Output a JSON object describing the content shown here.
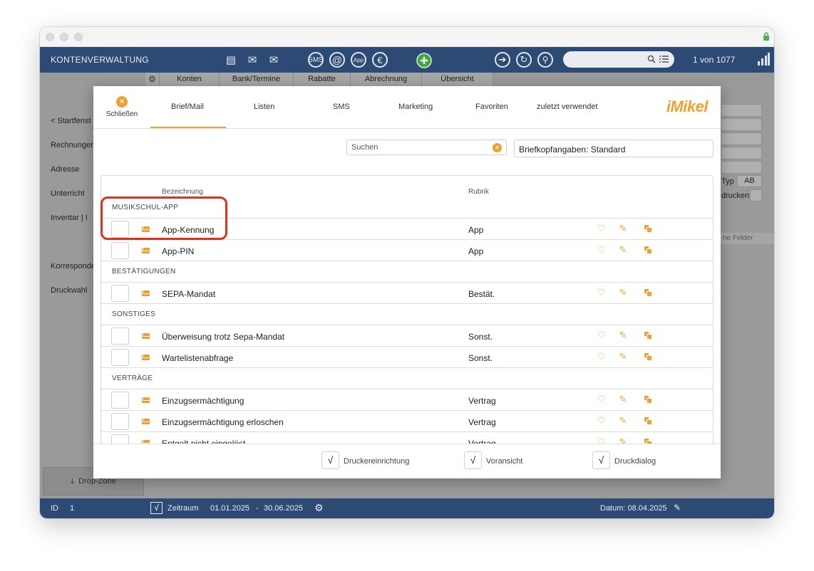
{
  "app": {
    "title": "KONTENVERWALTUNG",
    "counter": "1 von 1077"
  },
  "subtabs": [
    "Konten",
    "Bank/Termine",
    "Rabatte",
    "Abrechnung",
    "Übersicht"
  ],
  "sidebar": [
    "< Startfenst",
    "Rechnunger",
    "Adresse",
    "Unterricht",
    "Inventar | I",
    "Korresponde",
    "Druckwahl"
  ],
  "dropzone": "Drop-Zone",
  "background_fields": {
    "typ_label": "Typ",
    "typ_value": "AB",
    "drucken_label": "drucken",
    "felder_label": "ne Felder"
  },
  "footer": {
    "id_label": "ID",
    "id_value": "1",
    "zeitraum_label": "Zeitraum",
    "date_from": "01.01.2025",
    "date_sep": "-",
    "date_to": "30.06.2025",
    "datum": "Datum: 08.04.2025"
  },
  "modal": {
    "close_label": "Schließen",
    "tabs": [
      "Brief/Mail",
      "Listen",
      "SMS",
      "Marketing",
      "Favoriten",
      "zuletzt verwendet"
    ],
    "logo": "iMikel",
    "search_placeholder": "Suchen",
    "letterhead": "Briefkopfangaben: Standard",
    "columns": {
      "name": "Bezeichnung",
      "rubrik": "Rubrik"
    },
    "sections": [
      {
        "title": "MUSIKSCHUL-APP",
        "rows": [
          {
            "name": "App-Kennung",
            "rubrik": "App"
          },
          {
            "name": "App-PIN",
            "rubrik": "App"
          }
        ]
      },
      {
        "title": "BESTÄTIGUNGEN",
        "rows": [
          {
            "name": "SEPA-Mandat",
            "rubrik": "Bestät."
          }
        ]
      },
      {
        "title": "SONSTIGES",
        "rows": [
          {
            "name": "Überweisung trotz Sepa-Mandat",
            "rubrik": "Sonst."
          },
          {
            "name": "Wartelistenabfrage",
            "rubrik": "Sonst."
          }
        ]
      },
      {
        "title": "VERTRÄGE",
        "rows": [
          {
            "name": "Einzugsermächtigung",
            "rubrik": "Vertrag"
          },
          {
            "name": "Einzugsermächtigung erloschen",
            "rubrik": "Vertrag"
          },
          {
            "name": "Entgelt nicht eingelöst",
            "rubrik": "Vertrag"
          }
        ]
      }
    ],
    "footer_options": [
      {
        "label": "Druckereinrichtung",
        "checked": true
      },
      {
        "label": "Voransicht",
        "checked": true
      },
      {
        "label": "Druckdialog",
        "checked": true
      }
    ],
    "check_mark": "√"
  },
  "colors": {
    "accent": "#f0a030",
    "navy": "#2d4a74",
    "highlight": "#e0301e"
  }
}
